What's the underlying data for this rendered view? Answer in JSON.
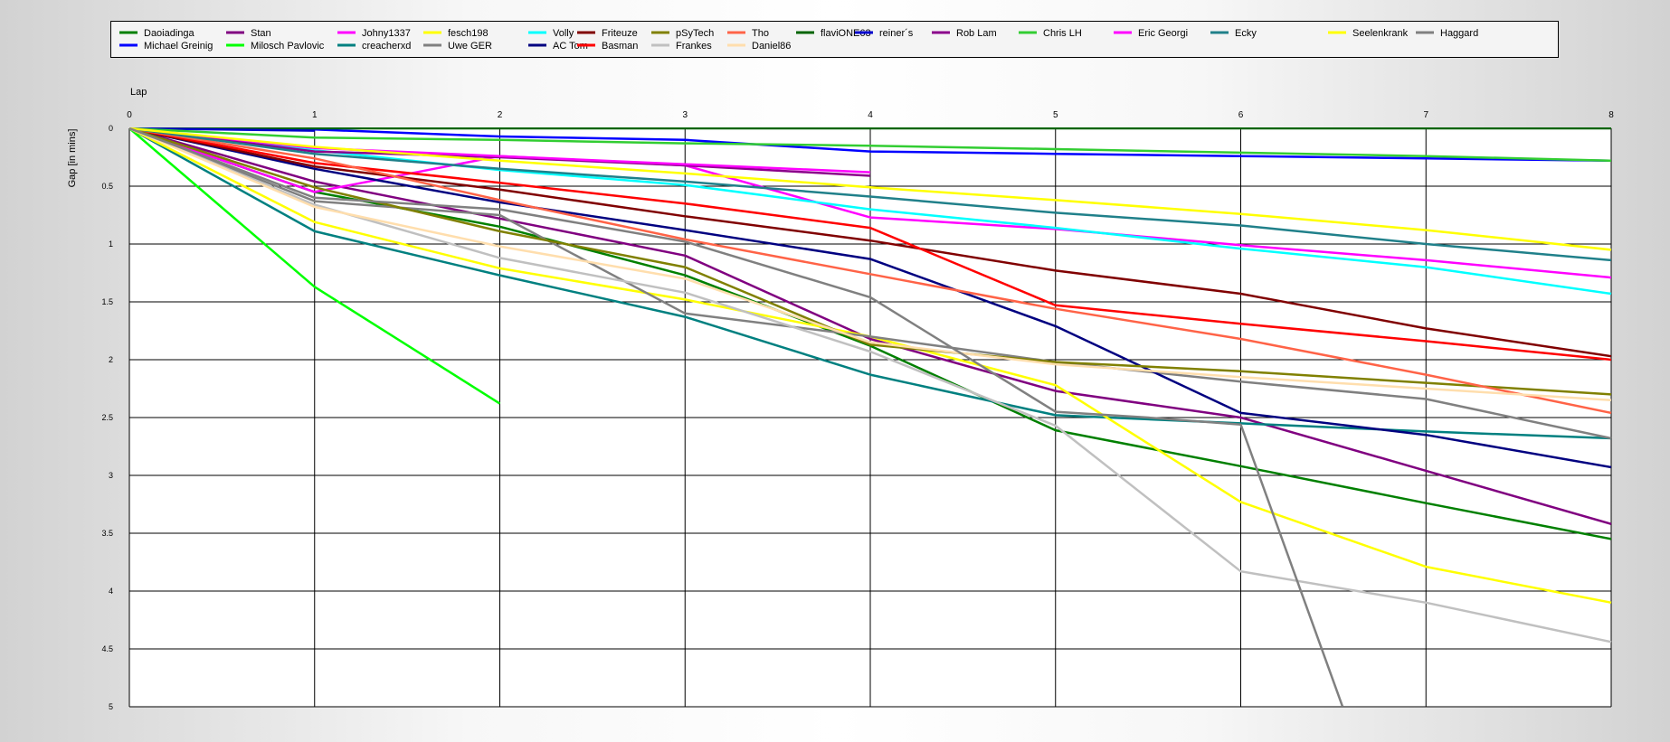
{
  "chart_data": {
    "type": "line",
    "xlabel": "Lap",
    "ylabel": "Gap [in mins]",
    "xlim": [
      0,
      8
    ],
    "ylim": [
      0,
      5
    ],
    "y_inverted": true,
    "grid": true,
    "legend_position": "top",
    "x_ticks": [
      "0",
      "1",
      "2",
      "3",
      "4",
      "5",
      "6",
      "7",
      "8"
    ],
    "y_ticks": [
      "0",
      "0.5",
      "1",
      "1.5",
      "2",
      "2.5",
      "3",
      "3.5",
      "4",
      "4.5",
      "5"
    ],
    "series": [
      {
        "name": "Daoiadinga",
        "color": "#008000",
        "x": [
          0,
          1,
          2,
          3,
          4,
          5,
          6,
          7,
          8
        ],
        "values": [
          0,
          0.55,
          0.85,
          1.27,
          1.88,
          2.61,
          2.92,
          3.24,
          3.55
        ]
      },
      {
        "name": "Michael Greinig",
        "color": "#0000ff",
        "x": [
          0,
          1,
          2,
          3,
          4,
          5,
          6,
          7,
          8
        ],
        "values": [
          0,
          0.01,
          0.07,
          0.1,
          0.2,
          0.22,
          0.24,
          0.26,
          0.28
        ]
      },
      {
        "name": "Stan",
        "color": "#800080",
        "x": [
          0,
          1,
          2,
          3,
          4,
          5,
          6,
          7,
          8
        ],
        "values": [
          0,
          0.46,
          0.78,
          1.1,
          1.82,
          2.27,
          2.5,
          2.96,
          3.42
        ]
      },
      {
        "name": "Milosch Pavlovic",
        "color": "#00ff00",
        "x": [
          0,
          1,
          2
        ],
        "values": [
          0,
          1.37,
          2.38
        ]
      },
      {
        "name": "Johny1337",
        "color": "#ff00ff",
        "x": [
          0,
          1,
          2,
          3,
          4,
          5,
          6,
          7,
          8
        ],
        "values": [
          0,
          0.55,
          0.24,
          0.32,
          0.77,
          0.87,
          1.01,
          1.14,
          1.29
        ]
      },
      {
        "name": "creacherxd",
        "color": "#008080",
        "x": [
          0,
          1,
          2,
          3,
          4,
          5,
          6,
          7,
          8
        ],
        "values": [
          0,
          0.89,
          1.27,
          1.63,
          2.13,
          2.48,
          2.55,
          2.62,
          2.68
        ]
      },
      {
        "name": "fesch198",
        "color": "#ffff00",
        "x": [
          0,
          1,
          2,
          3,
          4,
          5,
          6,
          7,
          8
        ],
        "values": [
          0,
          0.81,
          1.21,
          1.48,
          1.8,
          2.22,
          3.23,
          3.79,
          4.1
        ]
      },
      {
        "name": "Uwe GER",
        "color": "#808080",
        "x": [
          0,
          1,
          2,
          3,
          4,
          5,
          6,
          7,
          8
        ],
        "values": [
          0,
          0.63,
          0.75,
          1.6,
          1.8,
          2.02,
          2.19,
          2.34,
          2.68
        ]
      },
      {
        "name": "Volly",
        "color": "#00ffff",
        "x": [
          0,
          1,
          2,
          3,
          4,
          5,
          6,
          7,
          8
        ],
        "values": [
          0,
          0.19,
          0.36,
          0.49,
          0.7,
          0.86,
          1.04,
          1.2,
          1.43
        ]
      },
      {
        "name": "AC Tom",
        "color": "#000080",
        "x": [
          0,
          1,
          2,
          3,
          4,
          5,
          6,
          7,
          8
        ],
        "values": [
          0,
          0.35,
          0.64,
          0.88,
          1.13,
          1.71,
          2.46,
          2.65,
          2.93
        ]
      },
      {
        "name": "Friteuze",
        "color": "#800000",
        "x": [
          0,
          1,
          2,
          3,
          4,
          5,
          6,
          7,
          8
        ],
        "values": [
          0,
          0.33,
          0.53,
          0.76,
          0.97,
          1.23,
          1.43,
          1.73,
          1.97
        ]
      },
      {
        "name": "Basman",
        "color": "#ff0000",
        "x": [
          0,
          1,
          2,
          3,
          4,
          5,
          6,
          7,
          8
        ],
        "values": [
          0,
          0.3,
          0.47,
          0.65,
          0.86,
          1.53,
          1.69,
          1.84,
          2.0
        ]
      },
      {
        "name": "pSyTech",
        "color": "#808000",
        "x": [
          0,
          1,
          2,
          3,
          4,
          5,
          6,
          7,
          8
        ],
        "values": [
          0,
          0.51,
          0.89,
          1.2,
          1.87,
          2.02,
          2.1,
          2.2,
          2.3
        ]
      },
      {
        "name": "Frankes",
        "color": "#c0c0c0",
        "x": [
          0,
          1,
          2,
          3,
          4,
          5,
          6,
          7,
          8
        ],
        "values": [
          0,
          0.66,
          1.12,
          1.42,
          1.93,
          2.57,
          3.83,
          4.1,
          4.44
        ]
      },
      {
        "name": "Tho",
        "color": "#ff6347",
        "x": [
          0,
          1,
          2,
          3,
          4,
          5,
          6,
          7,
          8
        ],
        "values": [
          0,
          0.26,
          0.62,
          0.96,
          1.26,
          1.56,
          1.82,
          2.13,
          2.46
        ]
      },
      {
        "name": "Daniel86",
        "color": "#ffdead",
        "x": [
          0,
          1,
          2,
          3,
          4,
          5,
          6,
          7,
          8
        ],
        "values": [
          0,
          0.68,
          1.02,
          1.3,
          1.85,
          2.04,
          2.15,
          2.25,
          2.35
        ]
      },
      {
        "name": "flaviONE63",
        "color": "#006400",
        "x": [
          0,
          1,
          2,
          3,
          4,
          5,
          6,
          7,
          8
        ],
        "values": [
          0,
          0,
          0,
          0,
          0,
          0,
          0,
          0,
          0
        ]
      },
      {
        "name": "reiner´s",
        "color": "#0000cd",
        "x": [
          0,
          1
        ],
        "values": [
          0,
          0.02
        ]
      },
      {
        "name": "Rob Lam",
        "color": "#8b008b",
        "x": [
          0,
          1,
          2,
          3,
          4
        ],
        "values": [
          0,
          0.2,
          0.25,
          0.32,
          0.41
        ]
      },
      {
        "name": "Chris LH",
        "color": "#32cd32",
        "x": [
          0,
          1,
          2,
          3,
          4,
          5,
          6,
          7,
          8
        ],
        "values": [
          0,
          0.08,
          0.1,
          0.13,
          0.15,
          0.18,
          0.21,
          0.24,
          0.28
        ]
      },
      {
        "name": "Eric Georgi",
        "color": "#ff00ff",
        "x": [
          0,
          1,
          2,
          3,
          4
        ],
        "values": [
          0,
          0.17,
          0.24,
          0.31,
          0.38
        ]
      },
      {
        "name": "Ecky",
        "color": "#20808a",
        "x": [
          0,
          1,
          2,
          3,
          4,
          5,
          6,
          7,
          8
        ],
        "values": [
          0,
          0.22,
          0.35,
          0.46,
          0.59,
          0.73,
          0.84,
          1.0,
          1.14
        ]
      },
      {
        "name": "Seelenkrank",
        "color": "#ffff00",
        "x": [
          0,
          1,
          2,
          3,
          4,
          5,
          6,
          7,
          8
        ],
        "values": [
          0,
          0.16,
          0.28,
          0.39,
          0.51,
          0.62,
          0.74,
          0.88,
          1.05
        ]
      },
      {
        "name": "Haggard",
        "color": "#808080",
        "x": [
          0,
          1,
          2,
          3,
          4,
          5,
          5.5,
          6,
          6.55
        ],
        "values": [
          0,
          0.6,
          0.7,
          0.98,
          1.46,
          2.45,
          2.5,
          2.56,
          5.0
        ]
      }
    ]
  }
}
